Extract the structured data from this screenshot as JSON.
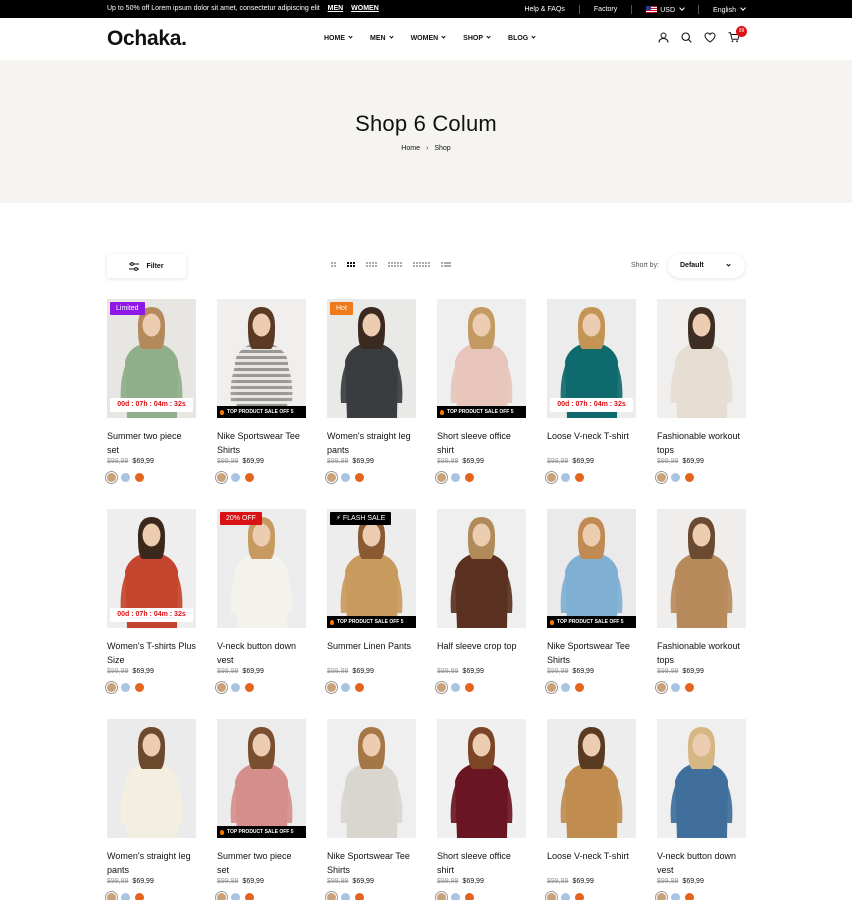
{
  "topbar": {
    "promo": "Up to 50% off Lorem ipsum dolor sit amet, consectetur adipiscing elit",
    "link_men": "MEN",
    "link_women": "WOMEN",
    "help": "Help & FAQs",
    "factory": "Factory",
    "currency": "USD",
    "language": "English"
  },
  "header": {
    "logo": "Ochaka.",
    "nav": [
      "HOME",
      "MEN",
      "WOMEN",
      "SHOP",
      "BLOG"
    ],
    "cart_count": "99"
  },
  "hero": {
    "title": "Shop 6 Colum",
    "crumb_home": "Home",
    "crumb_current": "Shop"
  },
  "toolbar": {
    "filter_label": "Filter",
    "sort_label": "Short by:",
    "sort_value": "Default"
  },
  "colors": {
    "accent": "#db1215",
    "tag_purple": "#8e19e6",
    "tag_orange": "#f07a1a",
    "tag_red": "#db1215",
    "swatch_tan": "#c9a27a",
    "swatch_blue": "#a9c4e0",
    "swatch_orange": "#e2641e"
  },
  "products": [
    {
      "name": "Summer two piece set",
      "old_price": "$99,99",
      "price": "$69,99",
      "tag": "Limited",
      "tag_color": "#8e19e6",
      "countdown": "00d : 07h : 04m : 32s",
      "sale_band": "",
      "bg": "#e7e6e3",
      "top": "#8fae8a",
      "pants": "#d7cfc3",
      "hair": "#b48a5c"
    },
    {
      "name": "Nike Sportswear Tee Shirts",
      "old_price": "$99,99",
      "price": "$69,99",
      "tag": "",
      "tag_color": "",
      "countdown": "",
      "sale_band": "TOP PRODUCT SALE OFF 5",
      "bg": "#f0efed",
      "top": "#d9d5cf",
      "pants": "#ccc5bb",
      "hair": "#5a3a25",
      "stripes": true
    },
    {
      "name": "Women's straight leg pants",
      "old_price": "$99,99",
      "price": "$69,99",
      "tag": "Hot",
      "tag_color": "#f07a1a",
      "countdown": "",
      "sale_band": "",
      "bg": "#e9e9e8",
      "top": "#3a3d3f",
      "pants": "#a8c0d6",
      "hair": "#3b2a20"
    },
    {
      "name": "Short sleeve office shirt",
      "old_price": "$99,99",
      "price": "$69,99",
      "tag": "",
      "tag_color": "",
      "countdown": "",
      "sale_band": "TOP PRODUCT SALE OFF 5",
      "bg": "#efefef",
      "top": "#e8c5bb",
      "pants": "#c9c0b3",
      "hair": "#c49a63"
    },
    {
      "name": "Loose V-neck T-shirt",
      "old_price": "$99,99",
      "price": "$69,99",
      "tag": "",
      "tag_color": "",
      "countdown": "00d : 07h : 04m : 32s",
      "sale_band": "",
      "bg": "#ececec",
      "top": "#0f6a6e",
      "pants": "#9bb6d0",
      "hair": "#c49455"
    },
    {
      "name": "Fashionable workout tops",
      "old_price": "$99,99",
      "price": "$69,99",
      "tag": "",
      "tag_color": "",
      "countdown": "",
      "sale_band": "",
      "bg": "#f0efee",
      "top": "#e6ddd2",
      "pants": "#5b4a32",
      "hair": "#3d2d22"
    },
    {
      "name": "Women's T-shirts Plus Size",
      "old_price": "$99,99",
      "price": "$69,99",
      "tag": "",
      "tag_color": "",
      "countdown": "00d : 07h : 04m : 32s",
      "sale_band": "",
      "bg": "#eeeeee",
      "top": "#c4452d",
      "pants": "#efe9e1",
      "hair": "#3b271c"
    },
    {
      "name": "V-neck button down vest",
      "old_price": "$99,99",
      "price": "$69,99",
      "tag": "20% OFF",
      "tag_color": "#db1215",
      "countdown": "",
      "sale_band": "",
      "bg": "#ececec",
      "top": "#f4f2ec",
      "pants": "#e8e5df",
      "hair": "#c79a5f"
    },
    {
      "name": "Summer Linen Pants",
      "old_price": "$99,99",
      "price": "$69,99",
      "tag": "⚡ FLASH SALE",
      "tag_color": "#000000",
      "countdown": "",
      "sale_band": "TOP PRODUCT SALE OFF 5",
      "bg": "#ededed",
      "top": "#c99a5e",
      "pants": "#d4c3a8",
      "hair": "#8a5a33"
    },
    {
      "name": "Half sleeve crop top",
      "old_price": "$99,99",
      "price": "$69,99",
      "tag": "",
      "tag_color": "",
      "countdown": "",
      "sale_band": "",
      "bg": "#efefef",
      "top": "#5a3120",
      "pants": "#3d5f8c",
      "hair": "#b18a5a"
    },
    {
      "name": "Nike Sportswear Tee Shirts",
      "old_price": "$99,99",
      "price": "$69,99",
      "tag": "",
      "tag_color": "",
      "countdown": "",
      "sale_band": "TOP PRODUCT SALE OFF 5",
      "bg": "#eaeaea",
      "top": "#7fb0d3",
      "pants": "#d6c9b7",
      "hair": "#c08a52"
    },
    {
      "name": "Fashionable workout tops",
      "old_price": "$99,99",
      "price": "$69,99",
      "tag": "",
      "tag_color": "",
      "countdown": "",
      "sale_band": "",
      "bg": "#efeeed",
      "top": "#b78a5c",
      "pants": "#8fb0cc",
      "hair": "#6a4a30"
    },
    {
      "name": "Women's straight leg pants",
      "old_price": "$99,99",
      "price": "$69,99",
      "tag": "",
      "tag_color": "",
      "countdown": "",
      "sale_band": "",
      "bg": "#ebebeb",
      "top": "#f3efe0",
      "pants": "#2f4e78",
      "hair": "#6b4a2e"
    },
    {
      "name": "Summer two piece set",
      "old_price": "$99,99",
      "price": "$69,99",
      "tag": "",
      "tag_color": "",
      "countdown": "",
      "sale_band": "TOP PRODUCT SALE OFF 5",
      "bg": "#ececec",
      "top": "#d58f8a",
      "pants": "#c7b7a6",
      "hair": "#7a4f30"
    },
    {
      "name": "Nike Sportswear Tee Shirts",
      "old_price": "$99,99",
      "price": "$69,99",
      "tag": "",
      "tag_color": "",
      "countdown": "",
      "sale_band": "",
      "bg": "#efefef",
      "top": "#d8d6cf",
      "pants": "#2c3f63",
      "hair": "#a57747"
    },
    {
      "name": "Short sleeve office shirt",
      "old_price": "$99,99",
      "price": "$69,99",
      "tag": "",
      "tag_color": "",
      "countdown": "",
      "sale_band": "",
      "bg": "#f0f0f0",
      "top": "#6a1622",
      "pants": "#e7e2d9",
      "hair": "#7b4526"
    },
    {
      "name": "Loose V-neck T-shirt",
      "old_price": "$99,99",
      "price": "$69,99",
      "tag": "",
      "tag_color": "",
      "countdown": "",
      "sale_band": "",
      "bg": "#ededed",
      "top": "#c08c50",
      "pants": "#e5ddd0",
      "hair": "#5a3b22"
    },
    {
      "name": "V-neck button down vest",
      "old_price": "$99,99",
      "price": "$69,99",
      "tag": "",
      "tag_color": "",
      "countdown": "",
      "sale_band": "",
      "bg": "#efefef",
      "top": "#3f6f9a",
      "pants": "#ddd3c5",
      "hair": "#d6b784"
    }
  ]
}
